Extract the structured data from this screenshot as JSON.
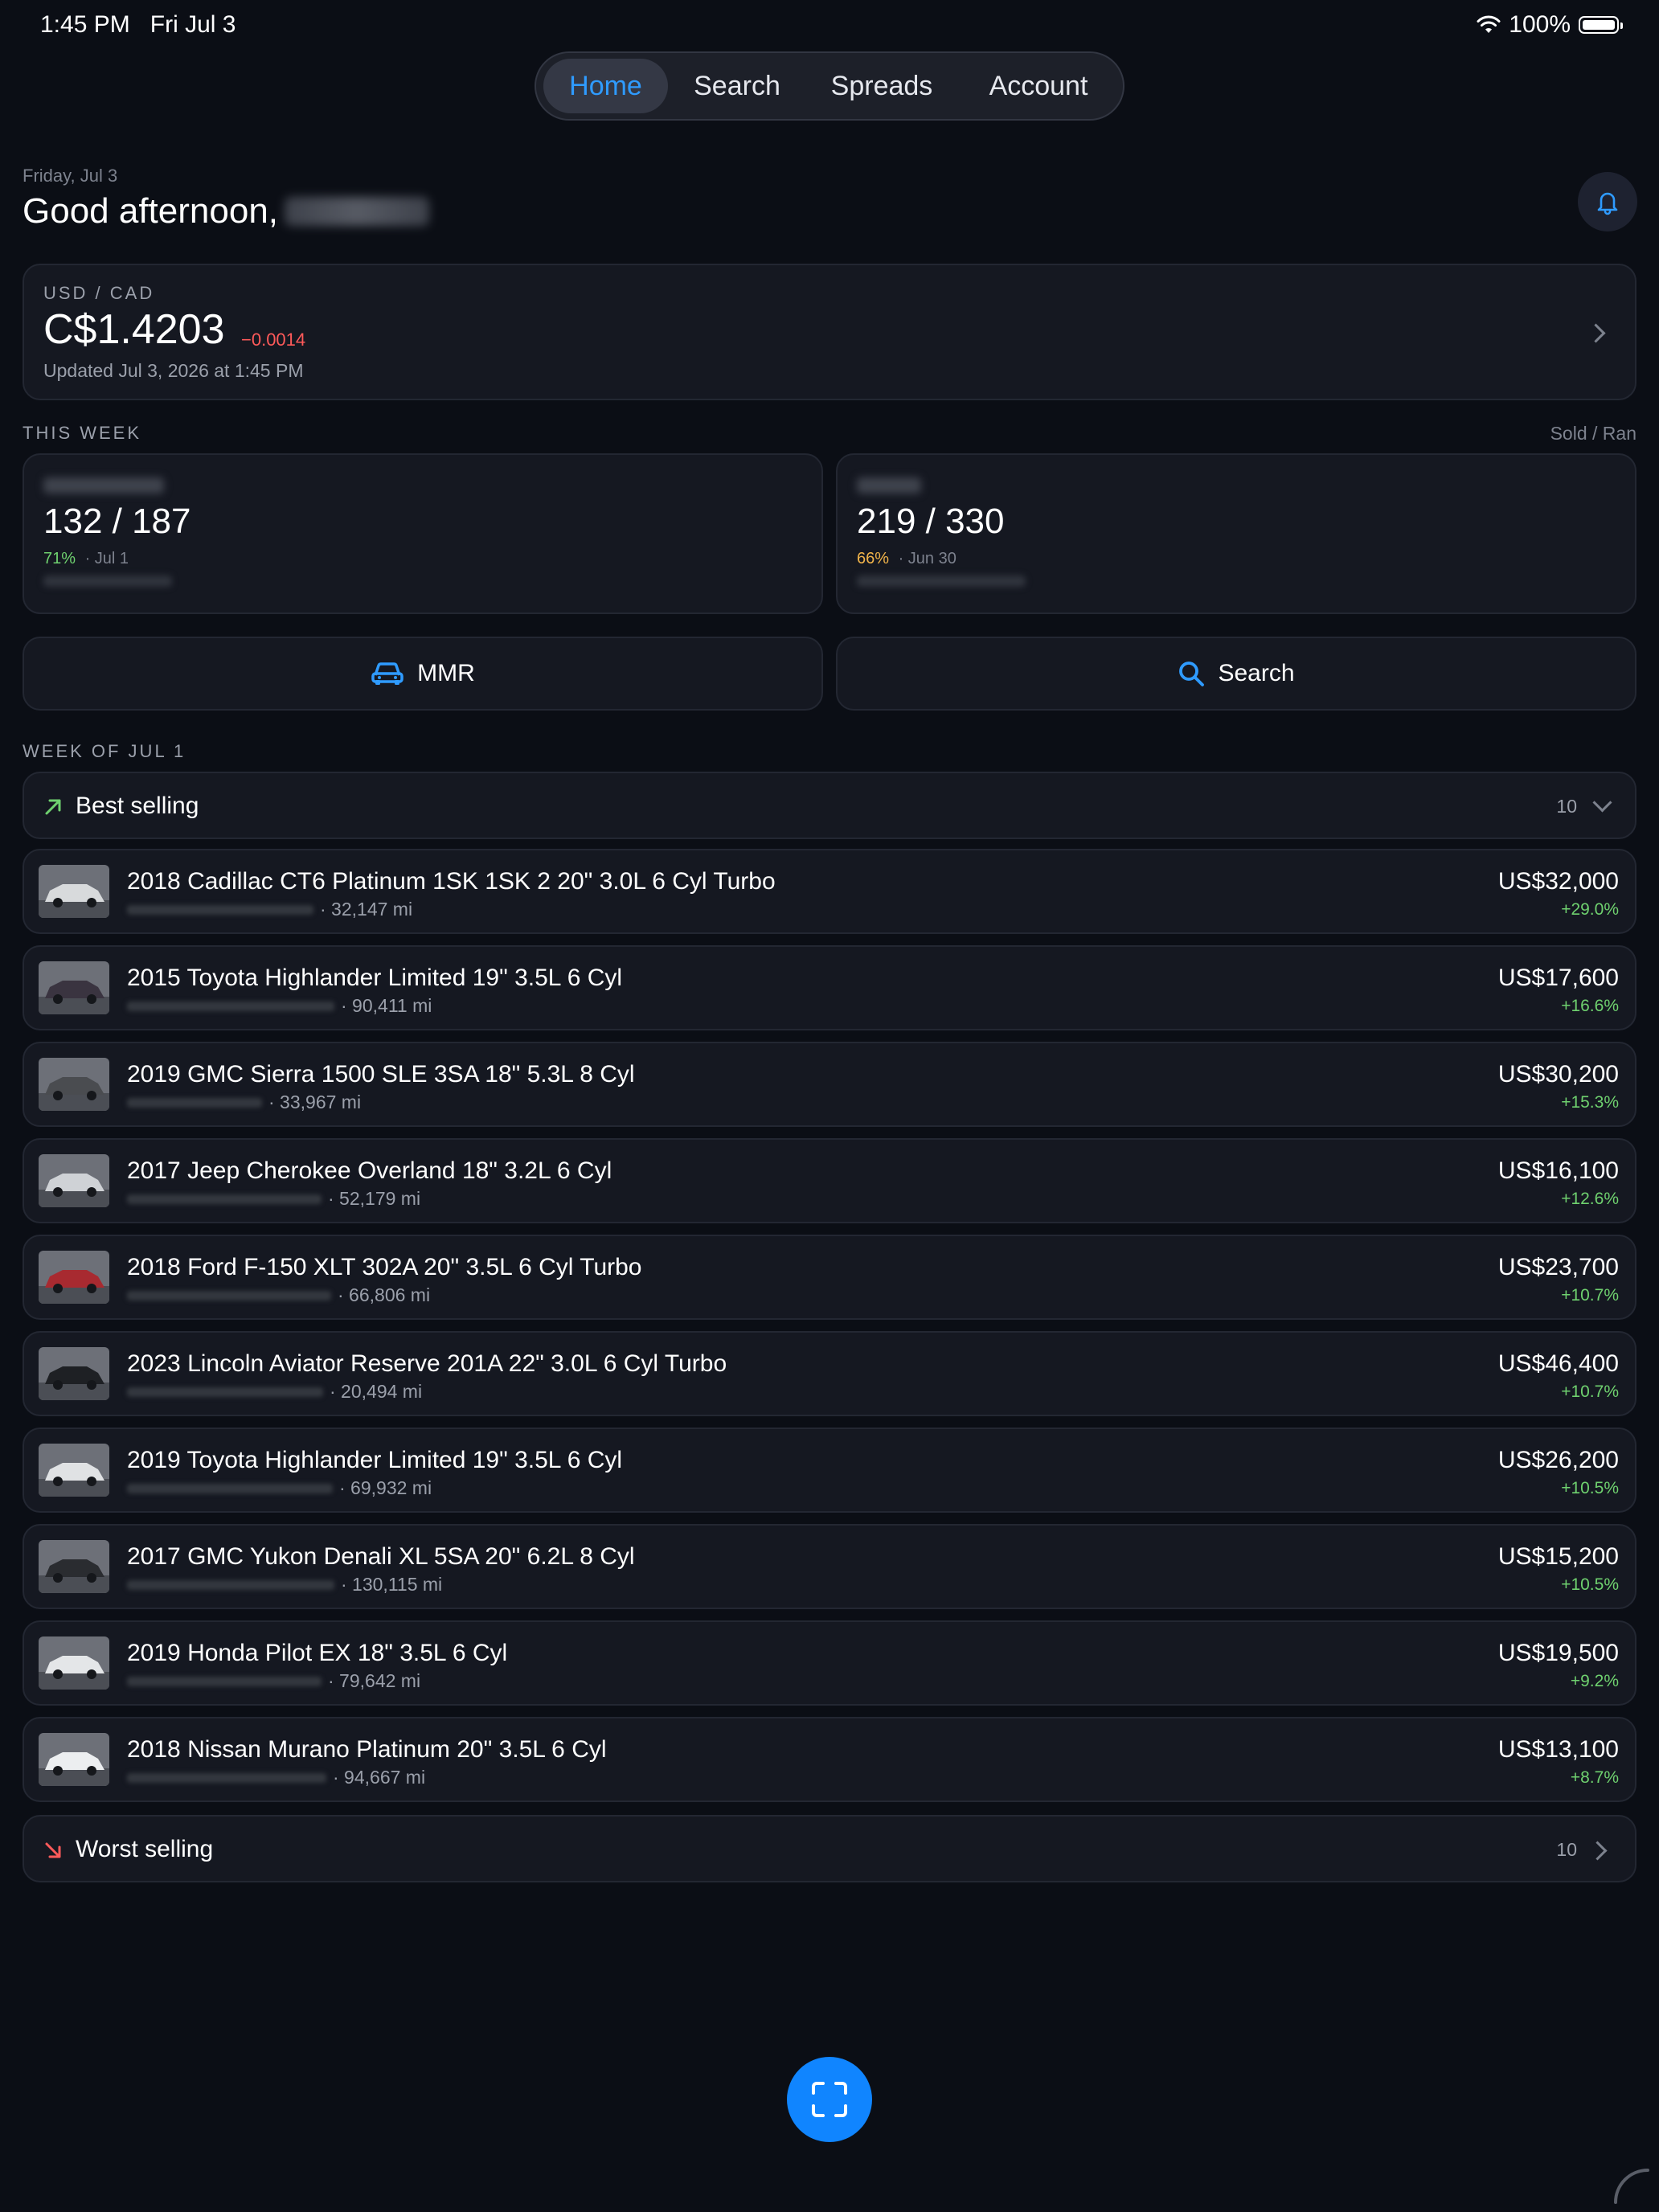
{
  "status_bar": {
    "time": "1:45 PM",
    "date": "Fri Jul 3",
    "battery": "100%"
  },
  "tabs": [
    {
      "label": "Home",
      "active": true
    },
    {
      "label": "Search",
      "active": false
    },
    {
      "label": "Spreads",
      "active": false
    },
    {
      "label": "Account",
      "active": false
    }
  ],
  "header": {
    "date": "Friday, Jul 3",
    "greeting": "Good afternoon,"
  },
  "fx": {
    "label": "USD / CAD",
    "rate": "C$1.4203",
    "change": "−0.0014",
    "updated": "Updated Jul 3, 2026 at 1:45 PM"
  },
  "this_week": {
    "label": "THIS WEEK",
    "legend": "Sold / Ran",
    "cards": [
      {
        "value": "132 / 187",
        "pct": "71%",
        "date": "· Jul 1",
        "pct_color": "#6fd16f"
      },
      {
        "value": "219 / 330",
        "pct": "66%",
        "date": "· Jun 30",
        "pct_color": "#f0b34a"
      }
    ]
  },
  "actions": {
    "mmr": "MMR",
    "search": "Search"
  },
  "week_of": {
    "label": "WEEK OF JUL 1",
    "best": {
      "title": "Best selling",
      "count": "10"
    },
    "worst": {
      "title": "Worst selling",
      "count": "10"
    }
  },
  "vehicles": [
    {
      "title": "2018 Cadillac CT6 Platinum 1SK 1SK 2 20\" 3.0L 6 Cyl Turbo",
      "miles": "· 32,147 mi",
      "price": "US$32,000",
      "change": "+29.0%",
      "color": "#d8dadc"
    },
    {
      "title": "2015 Toyota Highlander Limited 19\" 3.5L 6 Cyl",
      "miles": "· 90,411 mi",
      "price": "US$17,600",
      "change": "+16.6%",
      "color": "#3a3440"
    },
    {
      "title": "2019 GMC Sierra 1500 SLE 3SA 18\" 5.3L 8 Cyl",
      "miles": "· 33,967 mi",
      "price": "US$30,200",
      "change": "+15.3%",
      "color": "#4a4c50"
    },
    {
      "title": "2017 Jeep Cherokee Overland 18\" 3.2L 6 Cyl",
      "miles": "· 52,179 mi",
      "price": "US$16,100",
      "change": "+12.6%",
      "color": "#cfd2d6"
    },
    {
      "title": "2018 Ford F-150 XLT 302A 20\" 3.5L 6 Cyl Turbo",
      "miles": "· 66,806 mi",
      "price": "US$23,700",
      "change": "+10.7%",
      "color": "#a82a30"
    },
    {
      "title": "2023 Lincoln Aviator Reserve 201A 22\" 3.0L 6 Cyl Turbo",
      "miles": "· 20,494 mi",
      "price": "US$46,400",
      "change": "+10.7%",
      "color": "#1e2024"
    },
    {
      "title": "2019 Toyota Highlander Limited 19\" 3.5L 6 Cyl",
      "miles": "· 69,932 mi",
      "price": "US$26,200",
      "change": "+10.5%",
      "color": "#e0e2e4"
    },
    {
      "title": "2017 GMC Yukon Denali XL 5SA 20\" 6.2L 8 Cyl",
      "miles": "· 130,115 mi",
      "price": "US$15,200",
      "change": "+10.5%",
      "color": "#2a2c30"
    },
    {
      "title": "2019 Honda Pilot EX 18\" 3.5L 6 Cyl",
      "miles": "· 79,642 mi",
      "price": "US$19,500",
      "change": "+9.2%",
      "color": "#e4e6e8"
    },
    {
      "title": "2018 Nissan Murano Platinum 20\" 3.5L 6 Cyl",
      "miles": "· 94,667 mi",
      "price": "US$13,100",
      "change": "+8.7%",
      "color": "#eceef0"
    }
  ]
}
